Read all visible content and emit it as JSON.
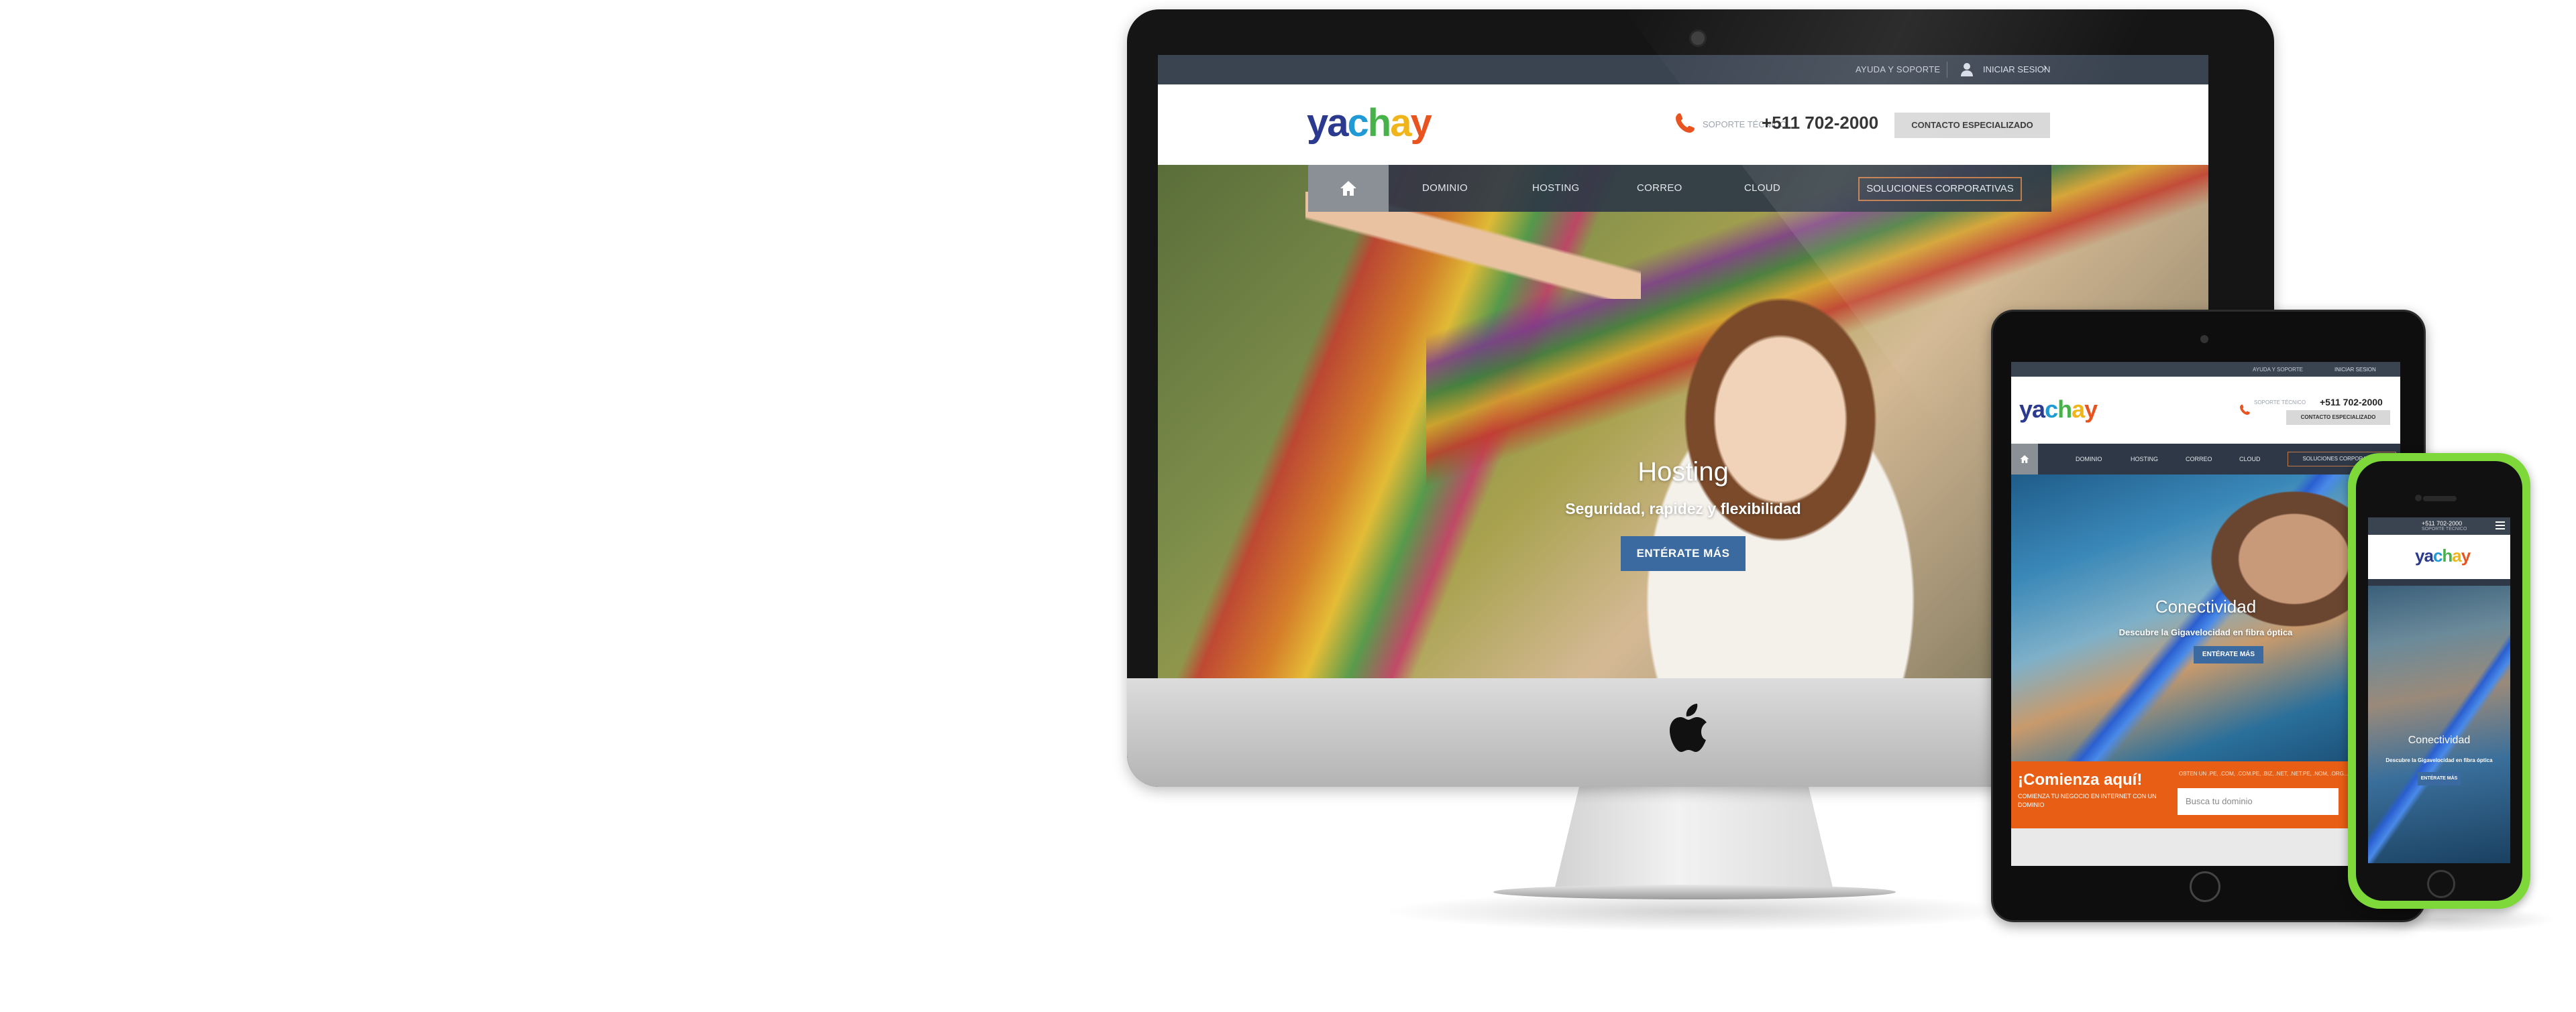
{
  "site": {
    "logo_letters": [
      "y",
      "a",
      "c",
      "h",
      "a",
      "y"
    ],
    "topbar": {
      "help": "AYUDA Y SOPORTE",
      "login": "INICIAR SESION"
    },
    "header": {
      "support_label": "SOPORTE TÉCNICO",
      "support_number": "+511 702-2000",
      "contact_button": "CONTACTO ESPECIALIZADO"
    },
    "nav": {
      "items": [
        "DOMINIO",
        "HOSTING",
        "CORREO",
        "CLOUD"
      ],
      "corporate": "SOLUCIONES CORPORATIVAS"
    }
  },
  "desktop_hero": {
    "title": "Hosting",
    "subtitle": "Seguridad, rapidez y flexibilidad",
    "button": "ENTÉRATE MÁS"
  },
  "tablet_hero": {
    "title": "Conectividad",
    "subtitle": "Descubre la Gigavelocidad en fibra óptica",
    "button": "ENTÉRATE MÁS"
  },
  "tablet_domain": {
    "title": "¡Comienza aquí!",
    "subtitle": "COMIENZA TU NEGOCIO EN INTERNET CON UN DOMINIO",
    "extensions": "OBTEN UN .PE, .COM, .COM.PE, .BIZ, .NET, .NET.PE, .NOM, .ORG...",
    "search_placeholder": "Busca tu dominio"
  },
  "mobile": {
    "number": "+511 702-2000",
    "sub": "SOPORTE TÉCNICO",
    "hero_title": "Conectividad",
    "hero_subtitle": "Descubre la Gigavelocidad en fibra óptica",
    "button": "ENTÉRATE MÁS"
  },
  "colors": {
    "topbar": "#3a4350",
    "accent_orange": "#e85e14",
    "button_blue": "#3b6aa0",
    "iphone_green": "#7fd83a"
  },
  "icons": [
    "home-icon",
    "phone-icon",
    "user-icon",
    "chevron-right-icon",
    "apple-logo-icon",
    "menu-icon"
  ]
}
